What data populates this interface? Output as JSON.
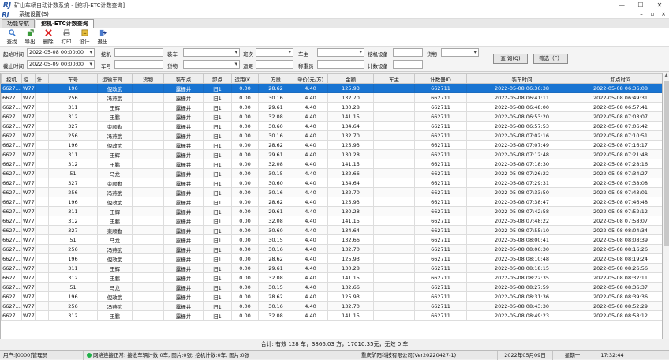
{
  "window": {
    "logo": "RJ",
    "title": "矿山车辆自动计数系统 - [挖机-ETC计数查询]",
    "minimize": "—",
    "maximize": "☐",
    "close": "✕"
  },
  "menu": {
    "item": "系统设置(S)",
    "right": [
      "–",
      "▫",
      "×"
    ]
  },
  "tabs": [
    {
      "label": "功能导航"
    },
    {
      "label": "挖机-ETC计数查询"
    }
  ],
  "toolbar": [
    {
      "label": "查找",
      "icon": "search-icon"
    },
    {
      "label": "导出",
      "icon": "export-icon"
    },
    {
      "label": "删除",
      "icon": "delete-icon"
    },
    {
      "label": "打印",
      "icon": "print-icon"
    },
    {
      "label": "设计",
      "icon": "design-icon"
    },
    {
      "label": "退出",
      "icon": "exit-icon"
    }
  ],
  "filter": {
    "start_time_label": "起始时间",
    "start_time": "2022-05-08 00:00:00",
    "end_time_label": "截止时间",
    "end_time": "2022-05-09 00:00:00",
    "excavator_label": "挖机",
    "plate_label": "车号",
    "loaded_label": "装车",
    "material_label": "货物",
    "unloaded_label": "卸点",
    "team_label": "班次",
    "path_label": "运距",
    "owner_label": "车主",
    "weigher_label": "称重员",
    "excavator_device_label": "挖机设备",
    "count_device_label": "计数设备",
    "goods_label": "货物",
    "query_button": "查 询(Q)",
    "filter_button": "筛选（F）"
  },
  "grid": {
    "headers": [
      "挖机",
      "挖...",
      "计...",
      "车号",
      "运输车司...",
      "货物",
      "装车点",
      "卸点",
      "运距(K...",
      "方量",
      "单价(元/方)",
      "金额",
      "车主",
      "计数器ID",
      "装车时间",
      "卸点时间"
    ],
    "rows": [
      [
        "6627...",
        "W77",
        "",
        "196",
        "倪政武",
        "",
        "露栅井",
        "旧1",
        "0.00",
        "28.62",
        "4.40",
        "125.93",
        "",
        "662711",
        "2022-05-08 06:36:38",
        "2022-05-08 06:36:08"
      ],
      [
        "6627...",
        "W77",
        "",
        "256",
        "冯燕武",
        "",
        "露栅井",
        "旧1",
        "0.00",
        "30.16",
        "4.40",
        "132.70",
        "",
        "662711",
        "2022-05-08 06:41:11",
        "2022-05-08 06:49:31"
      ],
      [
        "6627...",
        "W77",
        "",
        "311",
        "王辉",
        "",
        "露栅井",
        "旧1",
        "0.00",
        "29.61",
        "4.40",
        "130.28",
        "",
        "662711",
        "2022-05-08 06:48:00",
        "2022-05-08 06:57:41"
      ],
      [
        "6627...",
        "W77",
        "",
        "312",
        "王鹏",
        "",
        "露栅井",
        "旧1",
        "0.00",
        "32.08",
        "4.40",
        "141.15",
        "",
        "662711",
        "2022-05-08 06:53:20",
        "2022-05-08 07:03:07"
      ],
      [
        "6627...",
        "W77",
        "",
        "327",
        "栾顺勤",
        "",
        "露栅井",
        "旧1",
        "0.00",
        "30.60",
        "4.40",
        "134.64",
        "",
        "662711",
        "2022-05-08 06:57:53",
        "2022-05-08 07:06:42"
      ],
      [
        "6627...",
        "W77",
        "",
        "256",
        "冯燕武",
        "",
        "露栅井",
        "旧1",
        "0.00",
        "30.16",
        "4.40",
        "132.70",
        "",
        "662711",
        "2022-05-08 07:02:16",
        "2022-05-08 07:10:51"
      ],
      [
        "6627...",
        "W77",
        "",
        "196",
        "倪政武",
        "",
        "露栅井",
        "旧1",
        "0.00",
        "28.62",
        "4.40",
        "125.93",
        "",
        "662711",
        "2022-05-08 07:07:49",
        "2022-05-08 07:16:17"
      ],
      [
        "6627...",
        "W77",
        "",
        "311",
        "王辉",
        "",
        "露栅井",
        "旧1",
        "0.00",
        "29.61",
        "4.40",
        "130.28",
        "",
        "662711",
        "2022-05-08 07:12:48",
        "2022-05-08 07:21:48"
      ],
      [
        "6627...",
        "W77",
        "",
        "312",
        "王鹏",
        "",
        "露栅井",
        "旧1",
        "0.00",
        "32.08",
        "4.40",
        "141.15",
        "",
        "662711",
        "2022-05-08 07:18:30",
        "2022-05-08 07:28:16"
      ],
      [
        "6627...",
        "W77",
        "",
        "51",
        "马龙",
        "",
        "露栅井",
        "旧1",
        "0.00",
        "30.15",
        "4.40",
        "132.66",
        "",
        "662711",
        "2022-05-08 07:26:22",
        "2022-05-08 07:34:27"
      ],
      [
        "6627...",
        "W77",
        "",
        "327",
        "栾顺勤",
        "",
        "露栅井",
        "旧1",
        "0.00",
        "30.60",
        "4.40",
        "134.64",
        "",
        "662711",
        "2022-05-08 07:29:31",
        "2022-05-08 07:38:08"
      ],
      [
        "6627...",
        "W77",
        "",
        "256",
        "冯燕武",
        "",
        "露栅井",
        "旧1",
        "0.00",
        "30.16",
        "4.40",
        "132.70",
        "",
        "662711",
        "2022-05-08 07:33:50",
        "2022-05-08 07:43:01"
      ],
      [
        "6627...",
        "W77",
        "",
        "196",
        "倪政武",
        "",
        "露栅井",
        "旧1",
        "0.00",
        "28.62",
        "4.40",
        "125.93",
        "",
        "662711",
        "2022-05-08 07:38:47",
        "2022-05-08 07:46:48"
      ],
      [
        "6627...",
        "W77",
        "",
        "311",
        "王辉",
        "",
        "露栅井",
        "旧1",
        "0.00",
        "29.61",
        "4.40",
        "130.28",
        "",
        "662711",
        "2022-05-08 07:42:58",
        "2022-05-08 07:52:12"
      ],
      [
        "6627...",
        "W77",
        "",
        "312",
        "王鹏",
        "",
        "露栅井",
        "旧1",
        "0.00",
        "32.08",
        "4.40",
        "141.15",
        "",
        "662711",
        "2022-05-08 07:48:22",
        "2022-05-08 07:58:07"
      ],
      [
        "6627...",
        "W77",
        "",
        "327",
        "栾顺勤",
        "",
        "露栅井",
        "旧1",
        "0.00",
        "30.60",
        "4.40",
        "134.64",
        "",
        "662711",
        "2022-05-08 07:55:10",
        "2022-05-08 08:04:34"
      ],
      [
        "6627...",
        "W77",
        "",
        "51",
        "马龙",
        "",
        "露栅井",
        "旧1",
        "0.00",
        "30.15",
        "4.40",
        "132.66",
        "",
        "662711",
        "2022-05-08 08:00:41",
        "2022-05-08 08:08:39"
      ],
      [
        "6627...",
        "W77",
        "",
        "256",
        "冯燕武",
        "",
        "露栅井",
        "旧1",
        "0.00",
        "30.16",
        "4.40",
        "132.70",
        "",
        "662711",
        "2022-05-08 08:06:30",
        "2022-05-08 08:16:26"
      ],
      [
        "6627...",
        "W77",
        "",
        "196",
        "倪政武",
        "",
        "露栅井",
        "旧1",
        "0.00",
        "28.62",
        "4.40",
        "125.93",
        "",
        "662711",
        "2022-05-08 08:10:48",
        "2022-05-08 08:19:24"
      ],
      [
        "6627...",
        "W77",
        "",
        "311",
        "王辉",
        "",
        "露栅井",
        "旧1",
        "0.00",
        "29.61",
        "4.40",
        "130.28",
        "",
        "662711",
        "2022-05-08 08:18:15",
        "2022-05-08 08:26:56"
      ],
      [
        "6627...",
        "W77",
        "",
        "312",
        "王鹏",
        "",
        "露栅井",
        "旧1",
        "0.00",
        "32.08",
        "4.40",
        "141.15",
        "",
        "662711",
        "2022-05-08 08:22:35",
        "2022-05-08 08:32:11"
      ],
      [
        "6627...",
        "W77",
        "",
        "51",
        "马龙",
        "",
        "露栅井",
        "旧1",
        "0.00",
        "30.15",
        "4.40",
        "132.66",
        "",
        "662711",
        "2022-05-08 08:27:59",
        "2022-05-08 08:36:37"
      ],
      [
        "6627...",
        "W77",
        "",
        "196",
        "倪政武",
        "",
        "露栅井",
        "旧1",
        "0.00",
        "28.62",
        "4.40",
        "125.93",
        "",
        "662711",
        "2022-05-08 08:31:36",
        "2022-05-08 08:39:36"
      ],
      [
        "6627...",
        "W77",
        "",
        "256",
        "冯燕武",
        "",
        "露栅井",
        "旧1",
        "0.00",
        "30.16",
        "4.40",
        "132.70",
        "",
        "662711",
        "2022-05-08 08:43:30",
        "2022-05-08 08:52:29"
      ],
      [
        "6627...",
        "W77",
        "",
        "312",
        "王鹏",
        "",
        "露栅井",
        "旧1",
        "0.00",
        "32.08",
        "4.40",
        "141.15",
        "",
        "662711",
        "2022-05-08 08:49:23",
        "2022-05-08 08:58:12"
      ]
    ]
  },
  "summary": "合计: 有效 128 车，3866.03 方，17010.35元，无效 0 车",
  "status": {
    "user": "用户:[0000]管理员",
    "network": "网络连接正常: 接收车辆计数:0车, 图片:0张; 挖机计数:0车, 图片:0张",
    "company": "重庆矿阳科技有限公司(Ver20220427-1)",
    "date": "2022年05月09日",
    "weekday": "星期一",
    "time": "17:32:44"
  },
  "colors": {
    "selected_row": "#1874d2",
    "status_ok": "#21b14a"
  }
}
